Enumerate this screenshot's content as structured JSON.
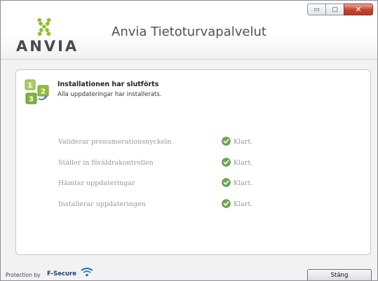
{
  "window": {
    "title": "Anvia Tietoturvapalvelut",
    "logo_text": "ANVIA",
    "controls": {
      "minimize": "▭",
      "maximize": "▢",
      "close": "✕"
    }
  },
  "status": {
    "title": "Installationen har slutförts",
    "subtitle": "Alla uppdateringar har installerats."
  },
  "steps": [
    {
      "label": "Validerar prenumerationsnyckeln",
      "status": "Klart."
    },
    {
      "label": "Ställer in föräldrakontrollen",
      "status": "Klart."
    },
    {
      "label": "Hämtar uppdateringar",
      "status": "Klart."
    },
    {
      "label": "Installerar uppdateringen",
      "status": "Klart."
    }
  ],
  "footer": {
    "protection_label": "Protection by",
    "brand": "F-Secure",
    "close_button": "Stäng"
  },
  "colors": {
    "logo_green": "#8cbf2b",
    "check_green": "#6aa84f",
    "close_red": "#c7412a"
  }
}
